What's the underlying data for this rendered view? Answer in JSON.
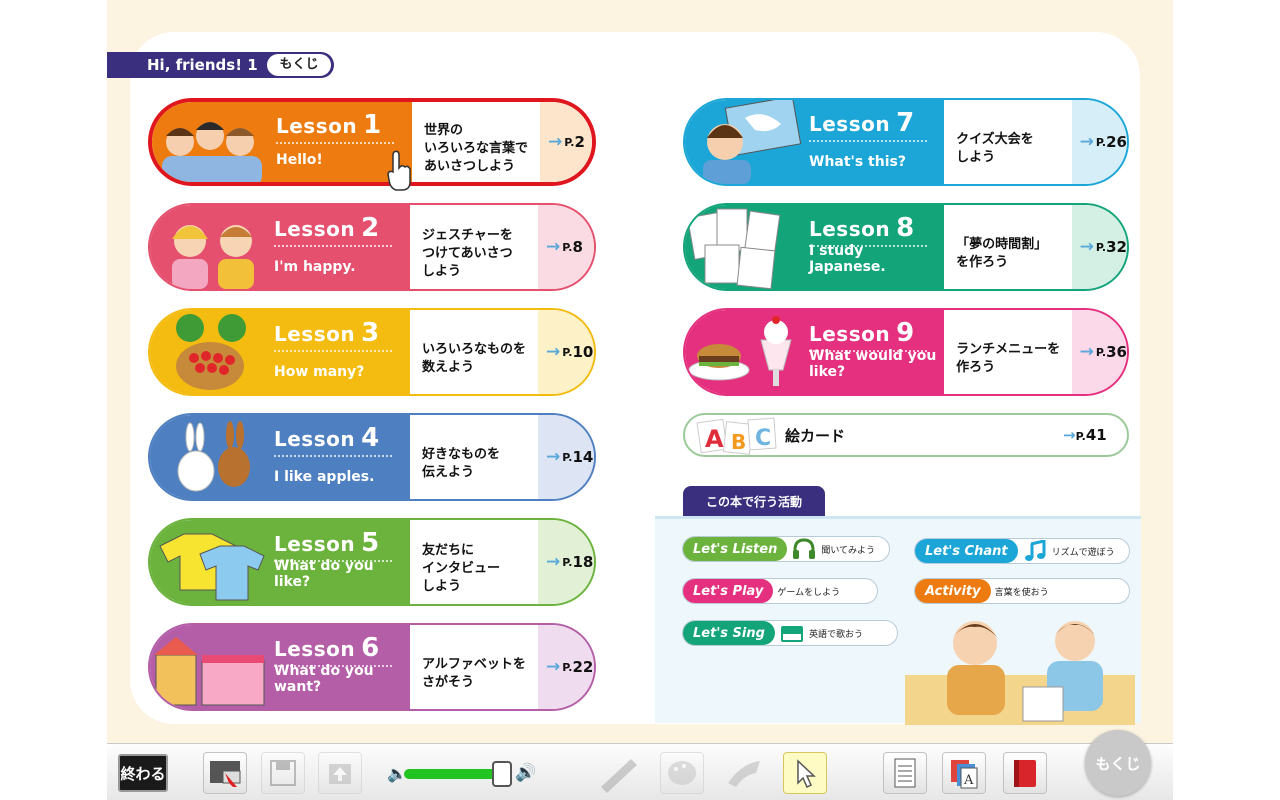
{
  "header": {
    "title": "Hi, friends! 1",
    "badge": "もくじ"
  },
  "lessons_left": [
    {
      "word": "Lesson",
      "num": "1",
      "eng": "Hello!",
      "jp": "世界の\nいろいろな言葉で\nあいさつしよう",
      "page": "2",
      "color": "#ed7b0f",
      "tint": "#fde5cc",
      "selected": true
    },
    {
      "word": "Lesson",
      "num": "2",
      "eng": "I'm happy.",
      "jp": "ジェスチャーを\nつけてあいさつ\nしよう",
      "page": "8",
      "color": "#e4506d",
      "tint": "#fbdbe3"
    },
    {
      "word": "Lesson",
      "num": "3",
      "eng": "How many?",
      "jp": "いろいろなものを\n数えよう",
      "page": "10",
      "color": "#f4bb10",
      "tint": "#fdf1c8"
    },
    {
      "word": "Lesson",
      "num": "4",
      "eng": "I like apples.",
      "jp": "好きなものを\n伝えよう",
      "page": "14",
      "color": "#4e7fc0",
      "tint": "#dde5f5"
    },
    {
      "word": "Lesson",
      "num": "5",
      "eng": "What do you\nlike?",
      "jp": "友だちに\nインタビュー\nしよう",
      "page": "18",
      "color": "#6cb33e",
      "tint": "#e2f1d6"
    },
    {
      "word": "Lesson",
      "num": "6",
      "eng": "What do you\nwant?",
      "jp": "アルファベットを\nさがそう",
      "page": "22",
      "color": "#b45ea7",
      "tint": "#f0dcef"
    }
  ],
  "lessons_right": [
    {
      "word": "Lesson",
      "num": "7",
      "eng": "What's this?",
      "jp": "クイズ大会を\nしよう",
      "page": "26",
      "color": "#1ba6d7",
      "tint": "#d6eef8"
    },
    {
      "word": "Lesson",
      "num": "8",
      "eng": "I study\nJapanese.",
      "jp": "「夢の時間割」\nを作ろう",
      "page": "32",
      "color": "#13a47a",
      "tint": "#d4efe3"
    },
    {
      "word": "Lesson",
      "num": "9",
      "eng": "What would you\nlike?",
      "jp": "ランチメニューを\n作ろう",
      "page": "36",
      "color": "#e5307f",
      "tint": "#fbd9e9"
    }
  ],
  "picture_cards": {
    "label": "絵カード",
    "page": "41",
    "letters": [
      "A",
      "B",
      "C"
    ]
  },
  "page_prefix": "P.",
  "activities": {
    "tab": "この本で行う活動",
    "items": [
      {
        "badge": "Let's Listen",
        "text": "聞いてみよう",
        "color": "#6cb33e",
        "icon": "headphones-icon"
      },
      {
        "badge": "Let's Chant",
        "text": "リズムで遊ぼう",
        "color": "#1ba6d7",
        "icon": "music-note-icon"
      },
      {
        "badge": "Let's Play",
        "text": "ゲームをしよう",
        "color": "#e5307f",
        "icon": ""
      },
      {
        "badge": "Activity",
        "text": "言葉を使おう",
        "color": "#ed7b0f",
        "icon": ""
      },
      {
        "badge": "Let's Sing",
        "text": "英語で歌おう",
        "color": "#13a47a",
        "icon": "piano-icon"
      }
    ]
  },
  "toolbar": {
    "end_label": "終わる",
    "mokuji_label": "もくじ",
    "volume": 0.95
  }
}
